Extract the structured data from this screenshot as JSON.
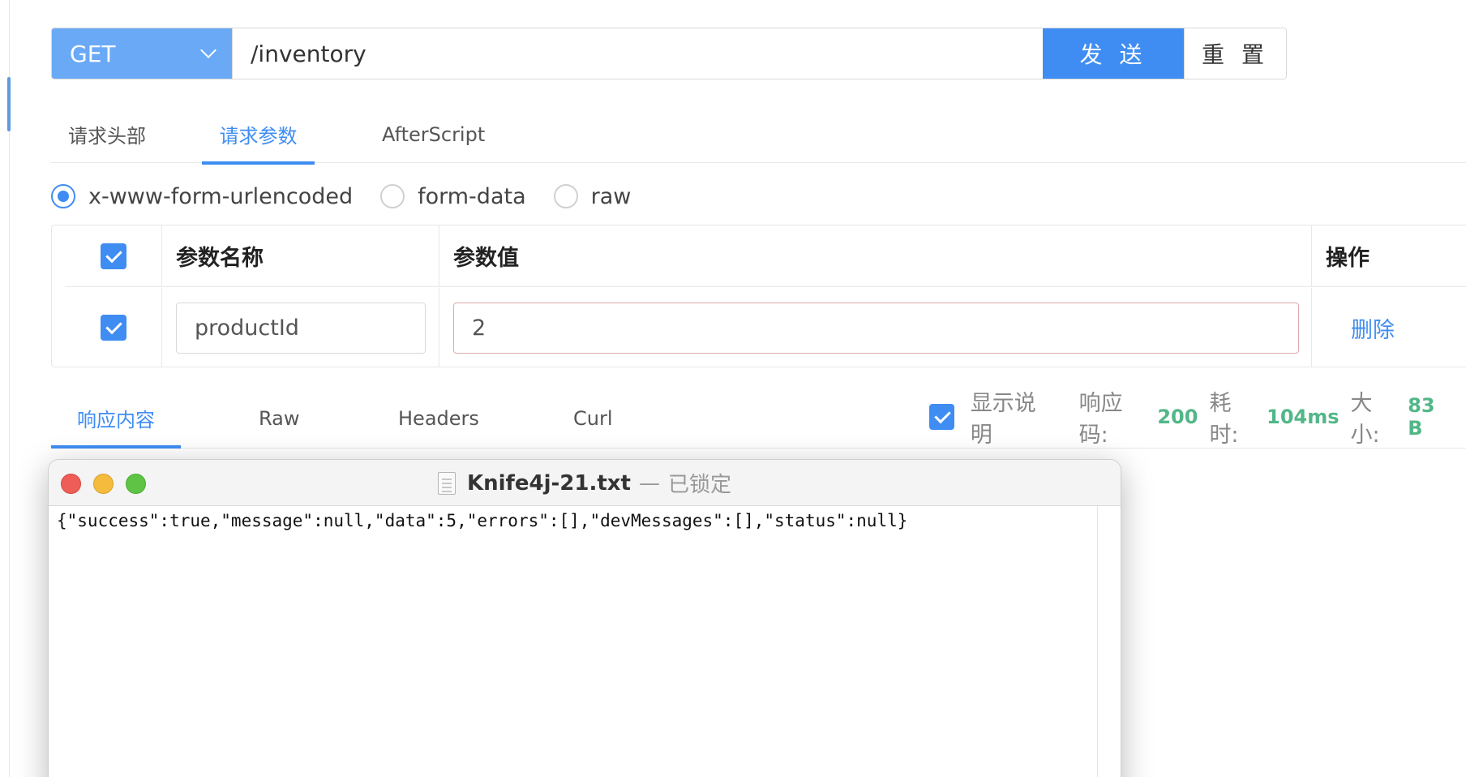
{
  "url_bar": {
    "method": "GET",
    "path": "/inventory",
    "send_label": "发 送",
    "reset_label": "重 置"
  },
  "request_tabs": [
    {
      "label": "请求头部",
      "active": false
    },
    {
      "label": "请求参数",
      "active": true
    },
    {
      "label": "AfterScript",
      "active": false
    }
  ],
  "body_types": [
    {
      "label": "x-www-form-urlencoded",
      "checked": true
    },
    {
      "label": "form-data",
      "checked": false
    },
    {
      "label": "raw",
      "checked": false
    }
  ],
  "params_table": {
    "headers": {
      "name": "参数名称",
      "value": "参数值",
      "op": "操作"
    },
    "rows": [
      {
        "checked": true,
        "name": "productId",
        "value": "2",
        "action": "删除"
      }
    ]
  },
  "response_tabs": [
    {
      "label": "响应内容",
      "active": true
    },
    {
      "label": "Raw",
      "active": false
    },
    {
      "label": "Headers",
      "active": false
    },
    {
      "label": "Curl",
      "active": false
    }
  ],
  "response_meta": {
    "show_desc_label": "显示说明",
    "show_desc_checked": true,
    "status_label": "响应码:",
    "status_value": "200",
    "time_label": "耗时:",
    "time_value": "104ms",
    "size_label": "大小:",
    "size_value": "83 B"
  },
  "text_window": {
    "filename": "Knife4j-21.txt",
    "separator": "—",
    "state": "已锁定",
    "content": "{\"success\":true,\"message\":null,\"data\":5,\"errors\":[],\"devMessages\":[],\"status\":null}"
  },
  "colors": {
    "accent": "#3f8df2",
    "method_bg": "#6aa9f5",
    "success_green": "#52b788"
  }
}
